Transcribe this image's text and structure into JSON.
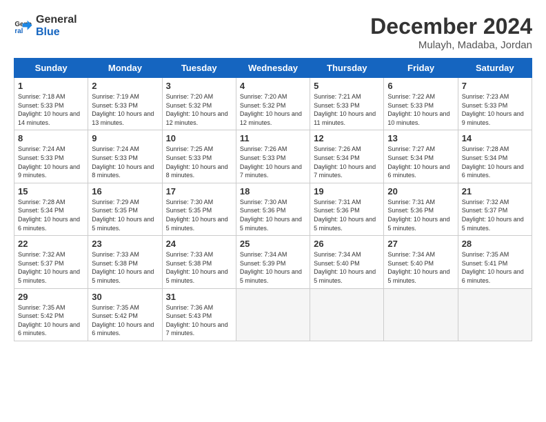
{
  "logo": {
    "line1": "General",
    "line2": "Blue"
  },
  "title": "December 2024",
  "subtitle": "Mulayh, Madaba, Jordan",
  "weekdays": [
    "Sunday",
    "Monday",
    "Tuesday",
    "Wednesday",
    "Thursday",
    "Friday",
    "Saturday"
  ],
  "weeks": [
    [
      {
        "day": "1",
        "sunrise": "7:18 AM",
        "sunset": "5:33 PM",
        "daylight": "10 hours and 14 minutes."
      },
      {
        "day": "2",
        "sunrise": "7:19 AM",
        "sunset": "5:33 PM",
        "daylight": "10 hours and 13 minutes."
      },
      {
        "day": "3",
        "sunrise": "7:20 AM",
        "sunset": "5:32 PM",
        "daylight": "10 hours and 12 minutes."
      },
      {
        "day": "4",
        "sunrise": "7:20 AM",
        "sunset": "5:32 PM",
        "daylight": "10 hours and 12 minutes."
      },
      {
        "day": "5",
        "sunrise": "7:21 AM",
        "sunset": "5:33 PM",
        "daylight": "10 hours and 11 minutes."
      },
      {
        "day": "6",
        "sunrise": "7:22 AM",
        "sunset": "5:33 PM",
        "daylight": "10 hours and 10 minutes."
      },
      {
        "day": "7",
        "sunrise": "7:23 AM",
        "sunset": "5:33 PM",
        "daylight": "10 hours and 9 minutes."
      }
    ],
    [
      {
        "day": "8",
        "sunrise": "7:24 AM",
        "sunset": "5:33 PM",
        "daylight": "10 hours and 9 minutes."
      },
      {
        "day": "9",
        "sunrise": "7:24 AM",
        "sunset": "5:33 PM",
        "daylight": "10 hours and 8 minutes."
      },
      {
        "day": "10",
        "sunrise": "7:25 AM",
        "sunset": "5:33 PM",
        "daylight": "10 hours and 8 minutes."
      },
      {
        "day": "11",
        "sunrise": "7:26 AM",
        "sunset": "5:33 PM",
        "daylight": "10 hours and 7 minutes."
      },
      {
        "day": "12",
        "sunrise": "7:26 AM",
        "sunset": "5:34 PM",
        "daylight": "10 hours and 7 minutes."
      },
      {
        "day": "13",
        "sunrise": "7:27 AM",
        "sunset": "5:34 PM",
        "daylight": "10 hours and 6 minutes."
      },
      {
        "day": "14",
        "sunrise": "7:28 AM",
        "sunset": "5:34 PM",
        "daylight": "10 hours and 6 minutes."
      }
    ],
    [
      {
        "day": "15",
        "sunrise": "7:28 AM",
        "sunset": "5:34 PM",
        "daylight": "10 hours and 6 minutes."
      },
      {
        "day": "16",
        "sunrise": "7:29 AM",
        "sunset": "5:35 PM",
        "daylight": "10 hours and 5 minutes."
      },
      {
        "day": "17",
        "sunrise": "7:30 AM",
        "sunset": "5:35 PM",
        "daylight": "10 hours and 5 minutes."
      },
      {
        "day": "18",
        "sunrise": "7:30 AM",
        "sunset": "5:36 PM",
        "daylight": "10 hours and 5 minutes."
      },
      {
        "day": "19",
        "sunrise": "7:31 AM",
        "sunset": "5:36 PM",
        "daylight": "10 hours and 5 minutes."
      },
      {
        "day": "20",
        "sunrise": "7:31 AM",
        "sunset": "5:36 PM",
        "daylight": "10 hours and 5 minutes."
      },
      {
        "day": "21",
        "sunrise": "7:32 AM",
        "sunset": "5:37 PM",
        "daylight": "10 hours and 5 minutes."
      }
    ],
    [
      {
        "day": "22",
        "sunrise": "7:32 AM",
        "sunset": "5:37 PM",
        "daylight": "10 hours and 5 minutes."
      },
      {
        "day": "23",
        "sunrise": "7:33 AM",
        "sunset": "5:38 PM",
        "daylight": "10 hours and 5 minutes."
      },
      {
        "day": "24",
        "sunrise": "7:33 AM",
        "sunset": "5:38 PM",
        "daylight": "10 hours and 5 minutes."
      },
      {
        "day": "25",
        "sunrise": "7:34 AM",
        "sunset": "5:39 PM",
        "daylight": "10 hours and 5 minutes."
      },
      {
        "day": "26",
        "sunrise": "7:34 AM",
        "sunset": "5:40 PM",
        "daylight": "10 hours and 5 minutes."
      },
      {
        "day": "27",
        "sunrise": "7:34 AM",
        "sunset": "5:40 PM",
        "daylight": "10 hours and 5 minutes."
      },
      {
        "day": "28",
        "sunrise": "7:35 AM",
        "sunset": "5:41 PM",
        "daylight": "10 hours and 6 minutes."
      }
    ],
    [
      {
        "day": "29",
        "sunrise": "7:35 AM",
        "sunset": "5:42 PM",
        "daylight": "10 hours and 6 minutes."
      },
      {
        "day": "30",
        "sunrise": "7:35 AM",
        "sunset": "5:42 PM",
        "daylight": "10 hours and 6 minutes."
      },
      {
        "day": "31",
        "sunrise": "7:36 AM",
        "sunset": "5:43 PM",
        "daylight": "10 hours and 7 minutes."
      },
      null,
      null,
      null,
      null
    ]
  ]
}
